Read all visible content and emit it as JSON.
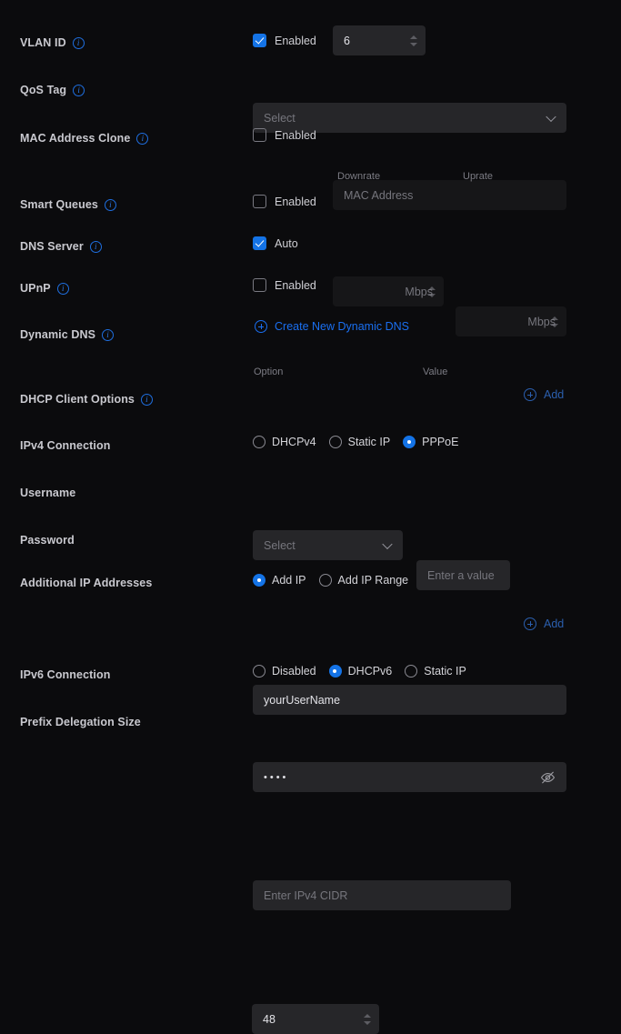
{
  "theme": {
    "bg": "#0b0b0d",
    "field_bg": "#262629",
    "field_bg_disabled": "#161618",
    "accent": "#1473e6",
    "link": "#1a6ff0",
    "link_dim": "#2b5fae",
    "label": "#c9c9cf",
    "placeholder": "#76767d"
  },
  "rows": {
    "vlan_id": {
      "label": "VLAN ID",
      "info_icon": "info-circle-icon",
      "checkbox_label": "Enabled",
      "checkbox_checked": true,
      "value": "6"
    },
    "qos_tag": {
      "label": "QoS Tag",
      "info_icon": "info-circle-icon",
      "select_value": "Select",
      "chevron_icon": "chevron-down-icon"
    },
    "mac_address_clone": {
      "label": "MAC Address Clone",
      "info_icon": "info-circle-icon",
      "checkbox_label": "Enabled",
      "checkbox_checked": false,
      "placeholder": "MAC Address"
    },
    "smart_queues": {
      "label": "Smart Queues",
      "info_icon": "info-circle-icon",
      "checkbox_label": "Enabled",
      "checkbox_checked": false,
      "downrate_caption": "Downrate",
      "downrate_placeholder": "Mbps",
      "uprate_caption": "Uprate",
      "uprate_placeholder": "Mbps"
    },
    "dns_server": {
      "label": "DNS Server",
      "info_icon": "info-circle-icon",
      "checkbox_label": "Auto",
      "checkbox_checked": true
    },
    "upnp": {
      "label": "UPnP",
      "info_icon": "info-circle-icon",
      "checkbox_label": "Enabled",
      "checkbox_checked": false
    },
    "dynamic_dns": {
      "label": "Dynamic DNS",
      "info_icon": "info-circle-icon",
      "link_label": "Create New Dynamic DNS",
      "link_icon": "plus-circle-icon"
    },
    "dhcp_client_options": {
      "label": "DHCP Client Options",
      "info_icon": "info-circle-icon",
      "option_caption": "Option",
      "option_select_value": "Select",
      "chevron_icon": "chevron-down-icon",
      "value_caption": "Value",
      "value_placeholder": "Enter a value",
      "add_label": "Add",
      "add_icon": "plus-circle-icon"
    },
    "ipv4_connection": {
      "label": "IPv4 Connection",
      "options": [
        {
          "label": "DHCPv4",
          "selected": false
        },
        {
          "label": "Static IP",
          "selected": false
        },
        {
          "label": "PPPoE",
          "selected": true
        }
      ]
    },
    "username": {
      "label": "Username",
      "value": "yourUserName"
    },
    "password": {
      "label": "Password",
      "value": "••••",
      "toggle_icon": "eye-off-icon"
    },
    "additional_ip_addresses": {
      "label": "Additional IP Addresses",
      "options": [
        {
          "label": "Add IP",
          "selected": true
        },
        {
          "label": "Add IP Range",
          "selected": false
        }
      ],
      "cidr_placeholder": "Enter IPv4 CIDR",
      "add_label": "Add",
      "add_icon": "plus-circle-icon"
    },
    "ipv6_connection": {
      "label": "IPv6 Connection",
      "options": [
        {
          "label": "Disabled",
          "selected": false
        },
        {
          "label": "DHCPv6",
          "selected": true
        },
        {
          "label": "Static IP",
          "selected": false
        }
      ]
    },
    "prefix_delegation_size": {
      "label": "Prefix Delegation Size",
      "value": "48"
    }
  }
}
